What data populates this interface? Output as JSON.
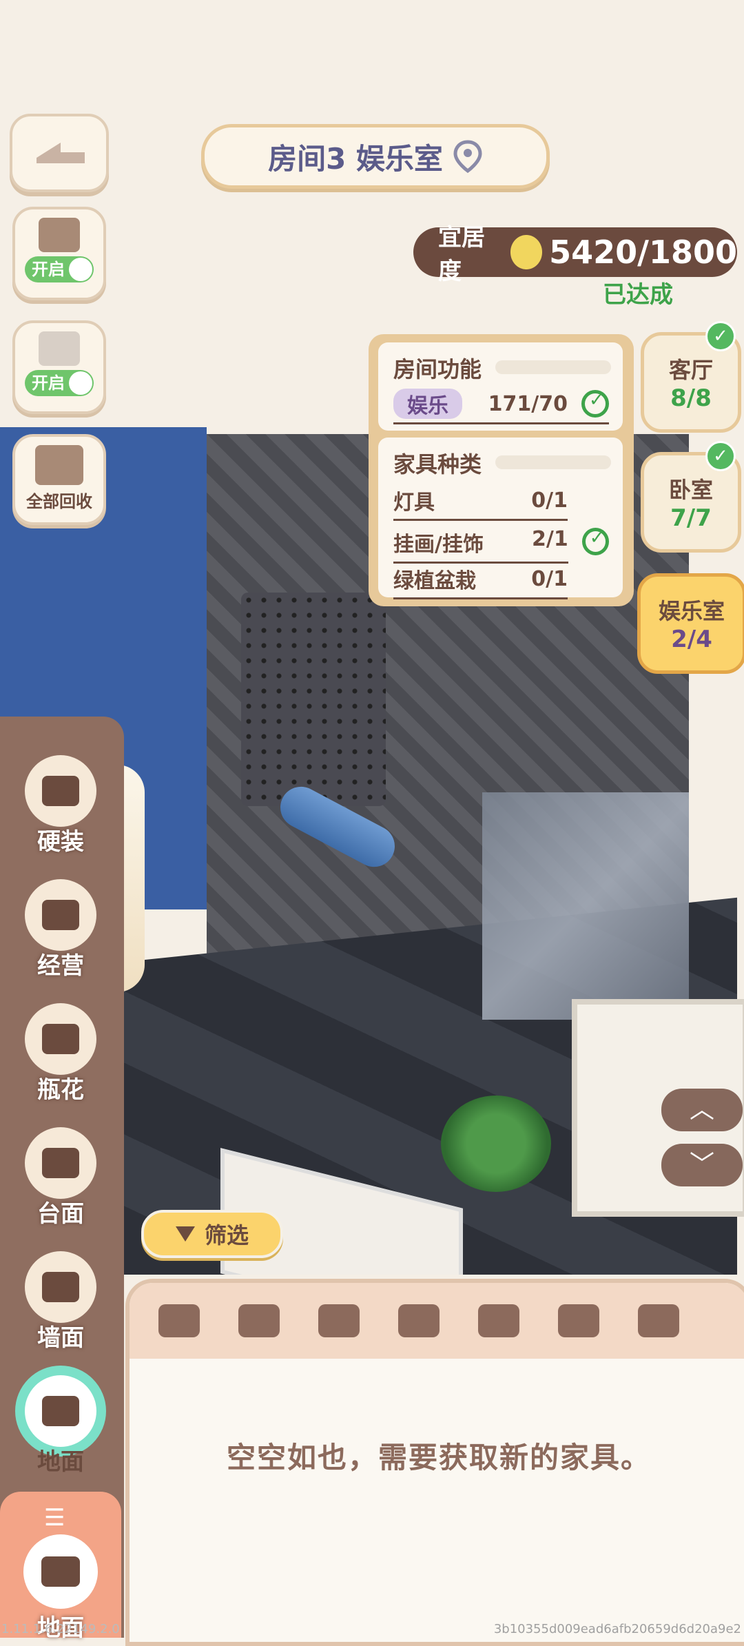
{
  "header": {
    "room_title": "房间3 娱乐室"
  },
  "tools": {
    "toggle1": "开启",
    "toggle2": "开启",
    "recycle": "全部回收"
  },
  "rating": {
    "label": "宜居度",
    "value": "5420/1800",
    "status": "已达成"
  },
  "function_panel": {
    "title": "房间功能",
    "tag": "娱乐",
    "tag_value": "171/70",
    "furniture_title": "家具种类",
    "rows": [
      {
        "name": "灯具",
        "value": "0/1",
        "done": false
      },
      {
        "name": "挂画/挂饰",
        "value": "2/1",
        "done": true
      },
      {
        "name": "绿植盆栽",
        "value": "0/1",
        "done": false
      }
    ]
  },
  "rooms": [
    {
      "name": "客厅",
      "count": "8/8",
      "done": true
    },
    {
      "name": "卧室",
      "count": "7/7",
      "done": true
    },
    {
      "name": "娱乐室",
      "count": "2/4",
      "done": false,
      "active": true
    }
  ],
  "categories": [
    {
      "label": "硬装",
      "icon": "shop-icon"
    },
    {
      "label": "经营",
      "icon": "paint-roller-icon"
    },
    {
      "label": "瓶花",
      "icon": "vase-icon"
    },
    {
      "label": "台面",
      "icon": "table-icon"
    },
    {
      "label": "墙面",
      "icon": "wall-frame-icon"
    },
    {
      "label": "地面",
      "icon": "sofa-icon"
    }
  ],
  "bottom_tab": {
    "label": "地面",
    "menu_icon": "☰"
  },
  "filter": {
    "label": "筛选"
  },
  "inventory": {
    "tab_icons": [
      "grid-icon",
      "sofa-icon",
      "shelf-icon",
      "bed-icon",
      "wardrobe-icon",
      "pot-icon",
      "bathtub-icon",
      "lamp-icon"
    ],
    "empty_message": "空空如也，需要获取新的家具。"
  },
  "arrows": {
    "up": "︿",
    "down": "﹀"
  },
  "footer": {
    "version": "1.11.1.6.22149.2.0",
    "hash": "3b10355d009ead6afb20659d6d20a9e2"
  }
}
